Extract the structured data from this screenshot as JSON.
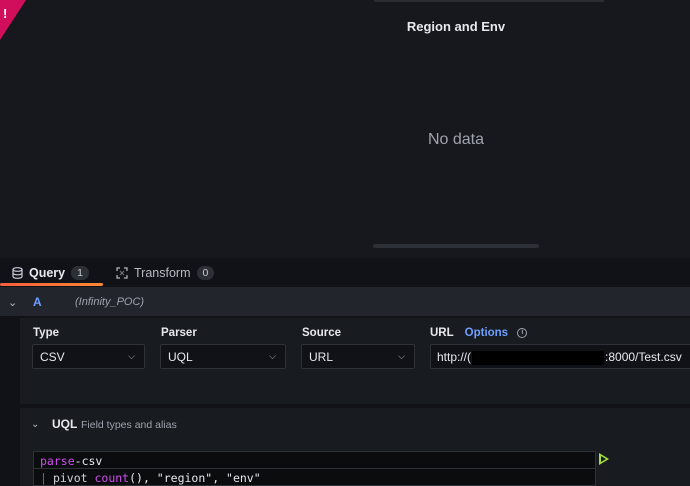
{
  "panel": {
    "title": "Region and Env",
    "empty_message": "No data",
    "error_indicator": "!"
  },
  "tabs": [
    {
      "label": "Query",
      "count": "1",
      "icon": "database-icon"
    },
    {
      "label": "Transform",
      "count": "0",
      "icon": "transform-icon"
    }
  ],
  "query": {
    "ref_id": "A",
    "datasource": "(Infinity_POC)"
  },
  "fields": {
    "type": {
      "label": "Type",
      "value": "CSV"
    },
    "parser": {
      "label": "Parser",
      "value": "UQL"
    },
    "source": {
      "label": "Source",
      "value": "URL"
    },
    "url": {
      "label": "URL",
      "options_label": "Options",
      "value_prefix": "http://(",
      "value_suffix": ":8000/Test.csv"
    }
  },
  "uql": {
    "title": "UQL",
    "subtitle": "Field types and alias",
    "line1": {
      "keyword": "parse",
      "dash": "-",
      "rest": "csv"
    },
    "line2": {
      "cmd": "pivot ",
      "fn": "count",
      "args": "(), \"region\", \"env\""
    }
  },
  "colors": {
    "accent_blue": "#6e9fff",
    "error_corner": "#d10e5c",
    "run_green": "#a6dd3b",
    "tab_underline": "#f55f3e"
  }
}
